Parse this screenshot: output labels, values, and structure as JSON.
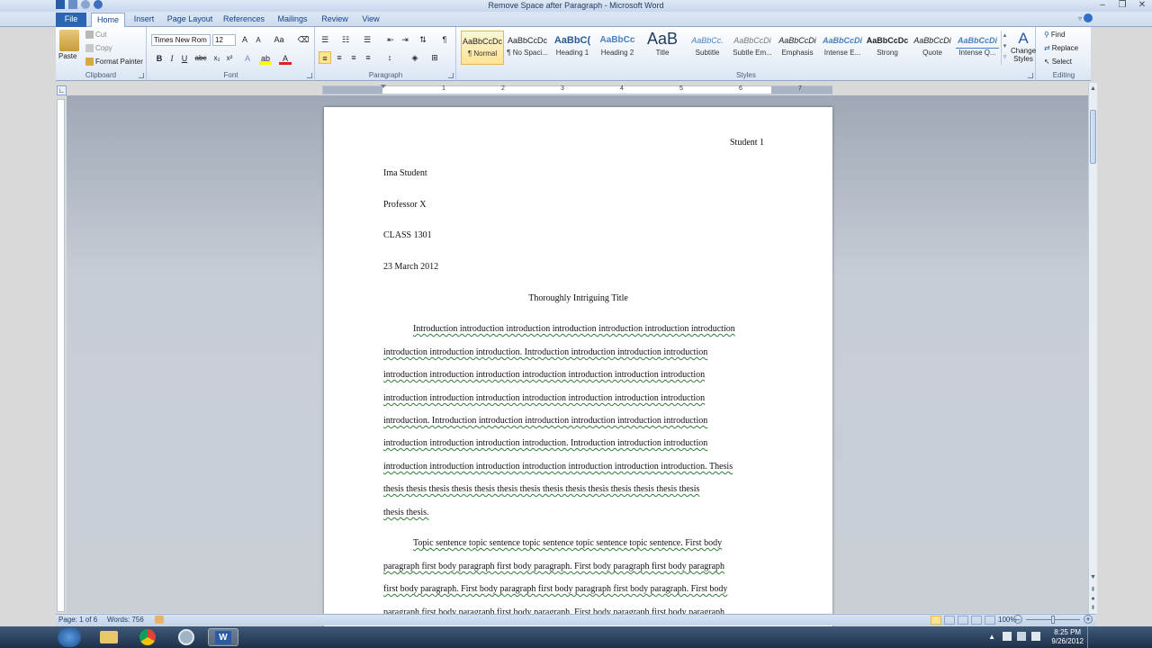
{
  "window": {
    "title": "Remove Space after Paragraph - Microsoft Word"
  },
  "tabs": [
    {
      "label": "File"
    },
    {
      "label": "Home"
    },
    {
      "label": "Insert"
    },
    {
      "label": "Page Layout"
    },
    {
      "label": "References"
    },
    {
      "label": "Mailings"
    },
    {
      "label": "Review"
    },
    {
      "label": "View"
    }
  ],
  "clipboard": {
    "paste": "Paste",
    "cut": "Cut",
    "copy": "Copy",
    "format_painter": "Format Painter",
    "label": "Clipboard"
  },
  "font": {
    "name": "Times New Rom",
    "size": "12",
    "label": "Font"
  },
  "paragraph": {
    "label": "Paragraph"
  },
  "styles": {
    "label": "Styles",
    "items": [
      {
        "sample": "AaBbCcDc",
        "name": "¶ Normal"
      },
      {
        "sample": "AaBbCcDc",
        "name": "¶ No Spaci..."
      },
      {
        "sample": "AaBbC(",
        "name": "Heading 1"
      },
      {
        "sample": "AaBbCc",
        "name": "Heading 2"
      },
      {
        "sample": "AaB",
        "name": "Title"
      },
      {
        "sample": "AaBbCc.",
        "name": "Subtitle"
      },
      {
        "sample": "AaBbCcDi",
        "name": "Subtle Em..."
      },
      {
        "sample": "AaBbCcDi",
        "name": "Emphasis"
      },
      {
        "sample": "AaBbCcDi",
        "name": "Intense E..."
      },
      {
        "sample": "AaBbCcDc",
        "name": "Strong"
      },
      {
        "sample": "AaBbCcDi",
        "name": "Quote"
      },
      {
        "sample": "AaBbCcDi",
        "name": "Intense Q..."
      }
    ],
    "change_styles": "Change Styles"
  },
  "editing": {
    "find": "Find",
    "replace": "Replace",
    "select": "Select",
    "label": "Editing"
  },
  "ruler": {
    "numbers": [
      "1",
      "2",
      "3",
      "4",
      "5",
      "6",
      "7"
    ]
  },
  "document": {
    "header": "Student 1",
    "name": "Ima Student",
    "professor": "Professor X",
    "class": "CLASS 1301",
    "date": "23 March 2012",
    "title": "Thoroughly Intriguing Title",
    "intro_lines": [
      "Introduction introduction introduction introduction introduction introduction introduction",
      "introduction introduction introduction. Introduction introduction introduction introduction",
      "introduction introduction introduction introduction introduction introduction introduction",
      "introduction introduction introduction introduction introduction introduction introduction",
      "introduction. Introduction introduction introduction introduction introduction introduction",
      "introduction introduction introduction introduction. Introduction introduction introduction",
      "introduction introduction introduction introduction introduction introduction introduction. Thesis",
      "thesis thesis thesis thesis thesis thesis thesis thesis thesis thesis thesis thesis thesis thesis",
      "thesis thesis."
    ],
    "body_lines": [
      "Topic sentence topic sentence topic sentence topic sentence topic sentence. First body",
      "paragraph first body paragraph first body paragraph. First body paragraph first body paragraph",
      "first body paragraph. First body paragraph first body paragraph first body paragraph. First body",
      "paragraph first body paragraph first body paragraph. First body paragraph first body paragraph"
    ]
  },
  "status": {
    "page": "Page: 1 of 6",
    "words": "Words: 756",
    "zoom": "100%"
  },
  "taskbar": {
    "time": "8:25 PM",
    "date": "9/26/2012"
  },
  "colors": {
    "accent": "#2a64b4",
    "spelling": "#d83030",
    "grammar": "#2f7d38"
  }
}
